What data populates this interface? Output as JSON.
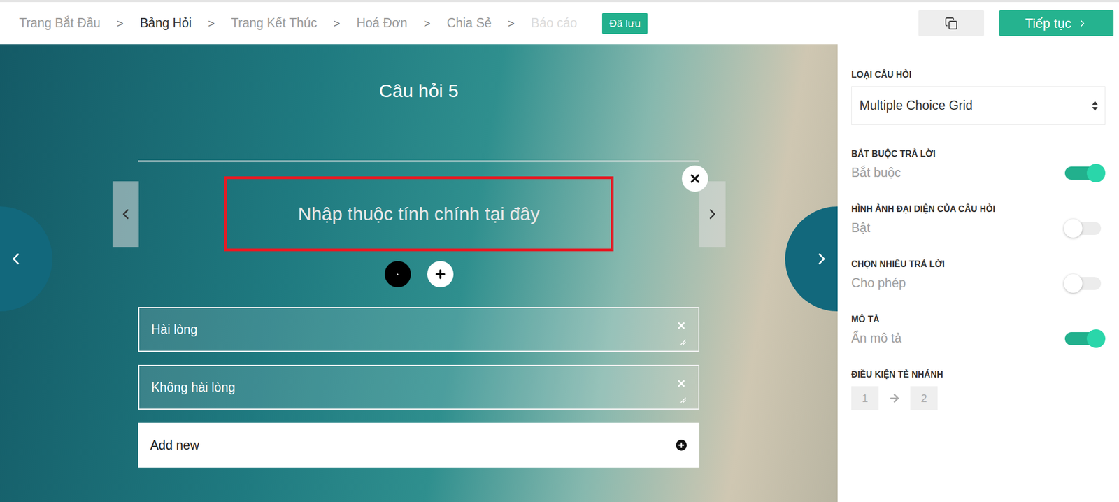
{
  "breadcrumbs": {
    "separator": ">",
    "items": [
      {
        "label": "Trang Bắt Đầu",
        "selected": false,
        "disabled": false
      },
      {
        "label": "Bảng Hỏi",
        "selected": true,
        "disabled": false
      },
      {
        "label": "Trang Kết Thúc",
        "selected": false,
        "disabled": false
      },
      {
        "label": "Hoá Đơn",
        "selected": false,
        "disabled": false
      },
      {
        "label": "Chia Sẻ",
        "selected": false,
        "disabled": false
      },
      {
        "label": "Báo cáo",
        "selected": false,
        "disabled": true
      }
    ]
  },
  "saved_badge": "Đã lưu",
  "continue_button": "Tiếp tục",
  "question": {
    "title": "Câu hỏi 5",
    "attribute_placeholder": "Nhập thuộc tính chính tại đây",
    "options": [
      "Hài lòng",
      "Không hài lòng"
    ],
    "add_new": "Add new"
  },
  "settings": {
    "question_type": {
      "label": "LOẠI CÂU HỎI",
      "value": "Multiple Choice Grid"
    },
    "toggles": [
      {
        "label": "BẮT BUỘC TRẢ LỜI",
        "text": "Bắt buộc",
        "on": true
      },
      {
        "label": "HÌNH ẢNH ĐẠI DIỆN CỦA CÂU HỎI",
        "text": "Bật",
        "on": false
      },
      {
        "label": "CHỌN NHIỀU TRẢ LỜI",
        "text": "Cho phép",
        "on": false
      },
      {
        "label": "MÔ TẢ",
        "text": "Ẩn mô tả",
        "on": true
      }
    ],
    "branching": {
      "label": "ĐIỀU KIỆN TẺ NHÁNH",
      "from": "1",
      "to": "2"
    }
  }
}
